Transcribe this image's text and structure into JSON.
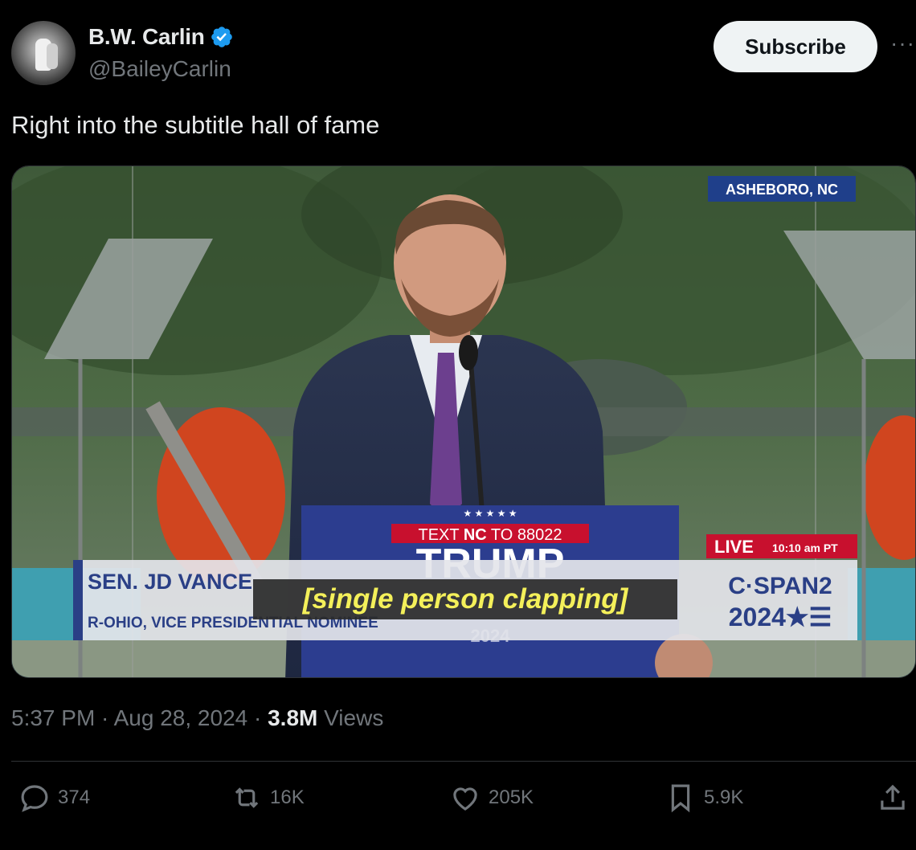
{
  "author": {
    "display_name": "B.W. Carlin",
    "handle": "@BaileyCarlin",
    "verified_icon": "verified-badge-icon"
  },
  "header": {
    "subscribe_label": "Subscribe",
    "more_label": "···"
  },
  "tweet": {
    "text": "Right into the subtitle hall of fame"
  },
  "media": {
    "location_tag": "ASHEBORO, NC",
    "podium_text_prefix": "TEXT ",
    "podium_text_code": "NC",
    "podium_text_suffix": " TO 88022",
    "podium_title": "TRUMP",
    "podium_year": "2024",
    "lower_third_name": "SEN. JD VANCE",
    "lower_third_title": "R-OHIO, VICE PRESIDENTIAL NOMINEE",
    "caption": "[single person clapping]",
    "live_label": "LIVE",
    "live_time": "10:10 am PT",
    "network_name": "C·SPAN2",
    "network_year": "2024★☰",
    "colors": {
      "lower_third_blue": "#2a3f86",
      "live_red": "#c8102e",
      "podium_blue": "#2c3d8f",
      "caption_yellow": "#f4f05a"
    }
  },
  "meta": {
    "time": "5:37 PM",
    "separator": " · ",
    "date": "Aug 28, 2024",
    "views_count": "3.8M",
    "views_label": " Views"
  },
  "actions": {
    "replies": "374",
    "reposts": "16K",
    "likes": "205K",
    "bookmarks": "5.9K"
  }
}
